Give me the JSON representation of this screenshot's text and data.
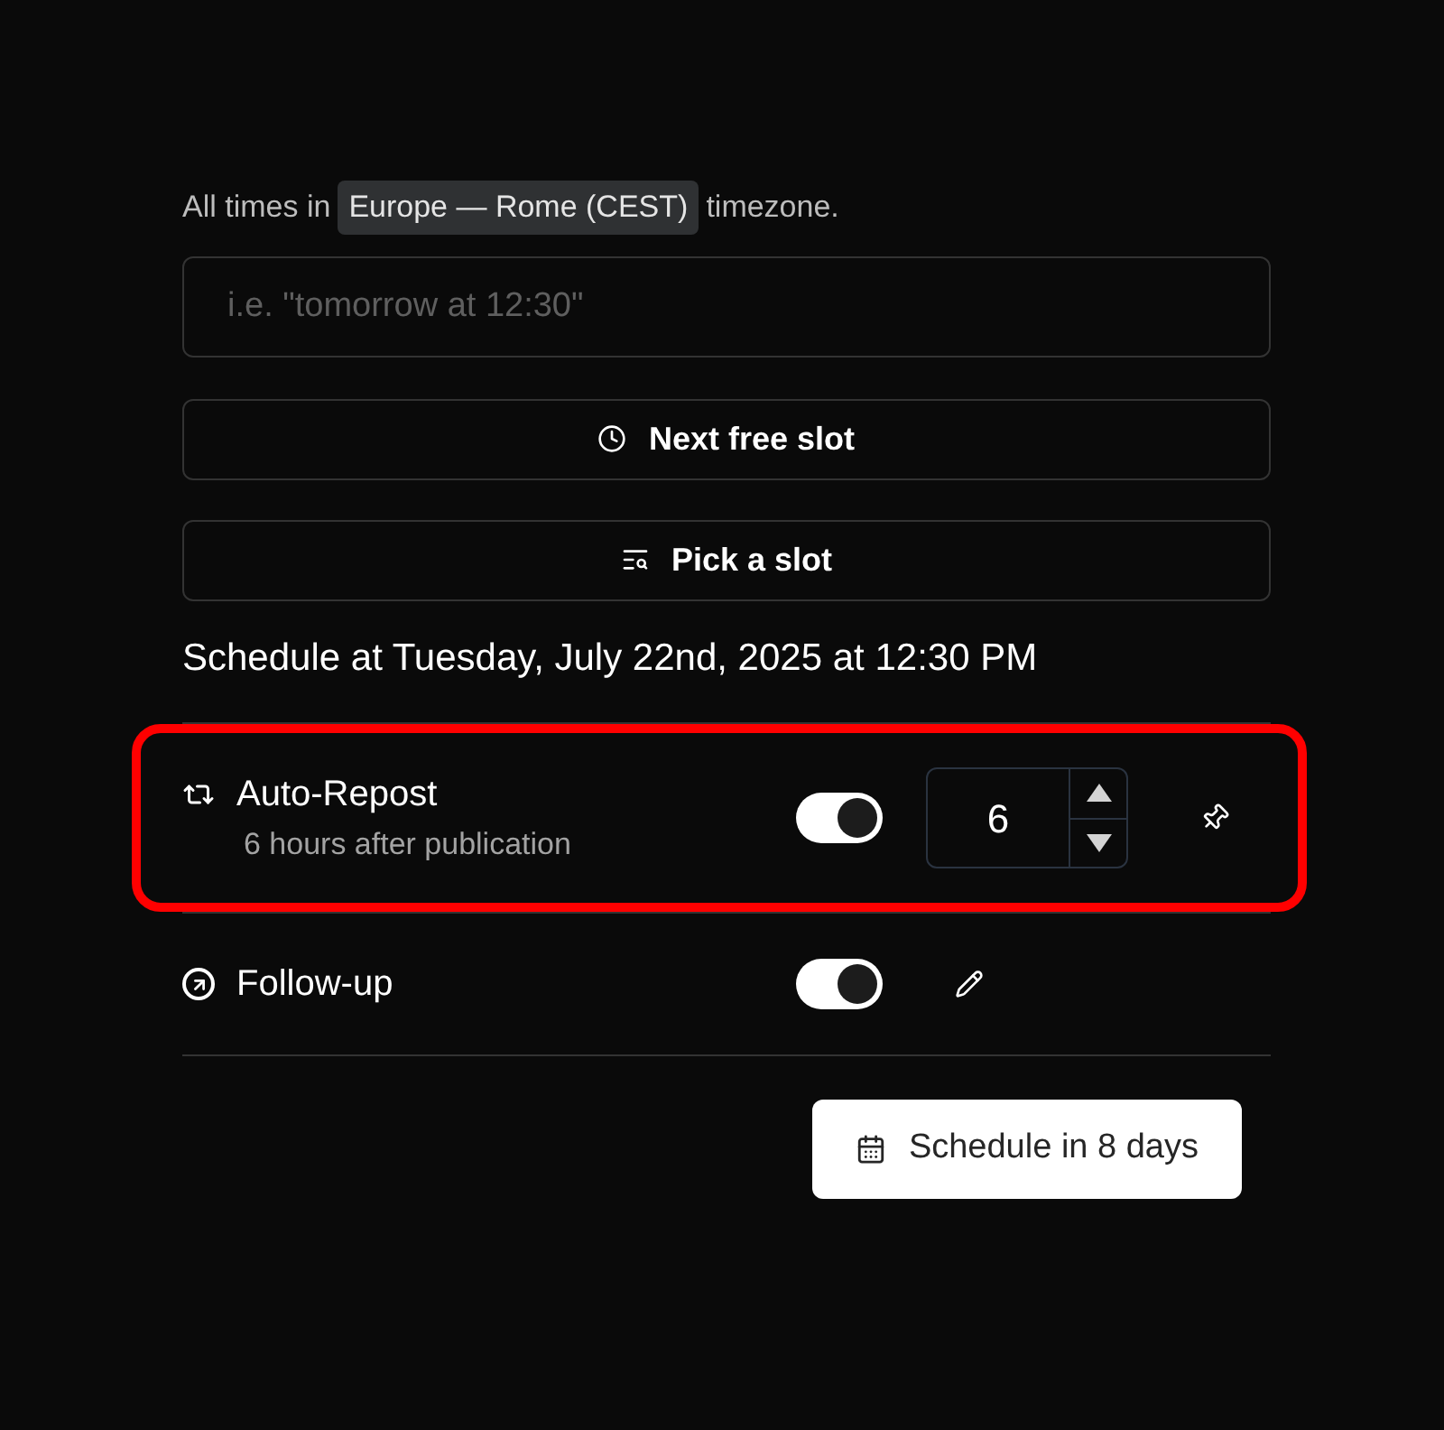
{
  "timezone_note": {
    "before": "All times in",
    "zone": "Europe — Rome (CEST)",
    "after": "timezone."
  },
  "date_input": {
    "placeholder": "i.e. \"tomorrow at 12:30\""
  },
  "slot_buttons": [
    {
      "label": "Next free slot",
      "kind": "clock"
    },
    {
      "label": "Pick a slot",
      "kind": "search-list"
    }
  ],
  "schedule_summary": "Schedule at Tuesday, July 22nd, 2025 at 12:30 PM",
  "options": [
    {
      "kind": "repost",
      "title": "Auto-Repost",
      "subtitle": "6 hours after publication",
      "on": true,
      "value": "6",
      "highlighted": true
    },
    {
      "kind": "followup",
      "title": "Follow-up",
      "on": true,
      "highlighted": false
    }
  ],
  "submit_button": {
    "label": "Schedule in 8 days"
  }
}
